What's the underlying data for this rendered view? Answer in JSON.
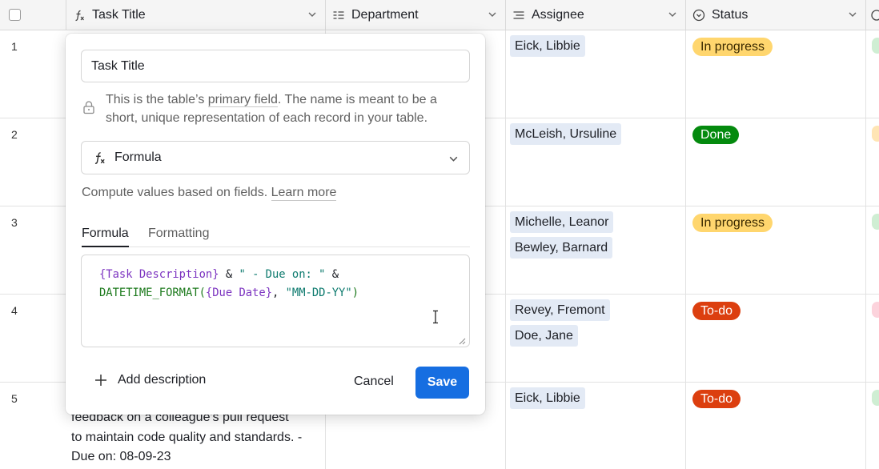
{
  "columns": [
    {
      "label": "Task Title",
      "icon": "formula-icon"
    },
    {
      "label": "Department",
      "icon": "list-icon"
    },
    {
      "label": "Assignee",
      "icon": "user-list-icon"
    },
    {
      "label": "Status",
      "icon": "status-icon"
    }
  ],
  "rows": [
    {
      "num": "1",
      "assignees": [
        "Eick, Libbie"
      ],
      "status": "In progress"
    },
    {
      "num": "2",
      "assignees": [
        "McLeish, Ursuline"
      ],
      "status": "Done"
    },
    {
      "num": "3",
      "assignees": [
        "Michelle, Leanor",
        "Bewley, Barnard"
      ],
      "status": "In progress"
    },
    {
      "num": "4",
      "assignees": [
        "Revey, Fremont",
        "Doe, Jane"
      ],
      "status": "To-do"
    },
    {
      "num": "5",
      "assignees": [
        "Eick, Libbie"
      ],
      "status": "To-do"
    }
  ],
  "row5_title_lines": [
    "feedback on a colleague's pull request",
    "to maintain code quality and standards. -",
    "Due on: 08-09-23"
  ],
  "status_colors": {
    "In progress": "#ffd66e",
    "Done": "#048a0e",
    "To-do": "#dc3f0f"
  },
  "popover": {
    "name_value": "Task Title",
    "info_text_before": "This is the table’s ",
    "info_link": "primary field",
    "info_text_after": ". The name is meant to be a short, unique representation of each record in your table.",
    "field_type": "Formula",
    "compute_text": "Compute values based on fields. ",
    "learn_more": "Learn more",
    "tabs": [
      "Formula",
      "Formatting"
    ],
    "formula_line1": {
      "field": "{Task Description}",
      "op1": " & ",
      "str": "\" - Due on: \"",
      "op2": " &"
    },
    "formula_line2": {
      "fn": "DATETIME_FORMAT(",
      "field": "{Due Date}",
      "sep": ", ",
      "str": "\"MM-DD-YY\"",
      "close": ")"
    },
    "add_description": "Add description",
    "cancel": "Cancel",
    "save": "Save"
  },
  "accent_color": "#166ee1"
}
